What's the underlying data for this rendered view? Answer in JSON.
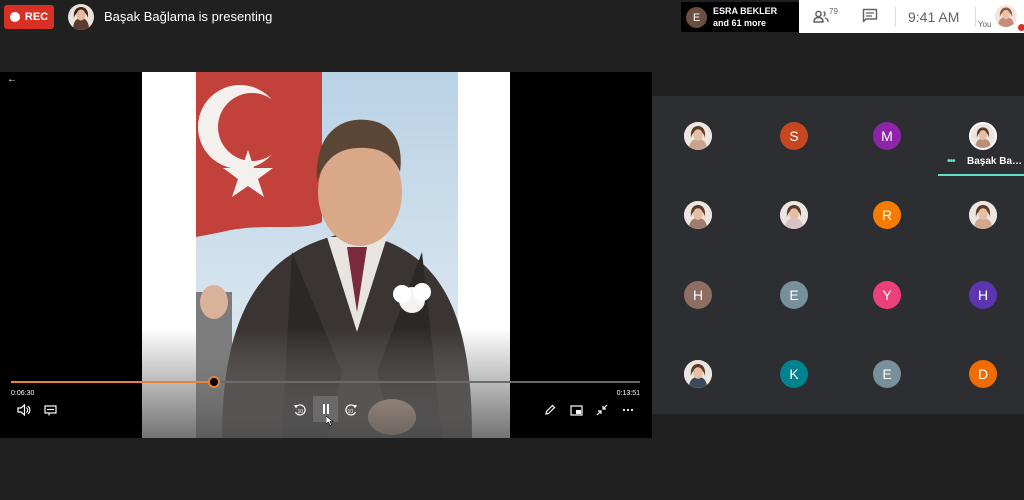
{
  "recording": {
    "label": "REC"
  },
  "presenter": {
    "text": "Başak Bağlama is presenting"
  },
  "participants_chip": {
    "initial": "E",
    "name": "ESRA BEKLER",
    "more": "and 61 more"
  },
  "toolbar": {
    "people_count": "79",
    "time": "9:41 AM",
    "you_label": "You"
  },
  "player": {
    "current_time": "0:06:30",
    "total_time": "0:13:51",
    "progress": 0.323
  },
  "grid": {
    "tiles": [
      {
        "type": "photo",
        "color": "#c9a38d"
      },
      {
        "type": "initial",
        "initial": "S",
        "color": "#c5461f"
      },
      {
        "type": "initial",
        "initial": "M",
        "color": "#8d24aa"
      },
      {
        "type": "photo",
        "color": "#b88f7a",
        "speaking": true,
        "name": "Başak Bağlama"
      },
      {
        "type": "photo",
        "color": "#a07a6a"
      },
      {
        "type": "photo",
        "color": "#d9c2c6"
      },
      {
        "type": "initial",
        "initial": "R",
        "color": "#f57c00"
      },
      {
        "type": "photo",
        "color": "#cfa890"
      },
      {
        "type": "initial",
        "initial": "H",
        "color": "#8d6e63"
      },
      {
        "type": "initial",
        "initial": "E",
        "color": "#78909c"
      },
      {
        "type": "initial",
        "initial": "Y",
        "color": "#ec407a"
      },
      {
        "type": "initial",
        "initial": "H",
        "color": "#5e35b1"
      },
      {
        "type": "photo",
        "color": "#3b4a5a"
      },
      {
        "type": "initial",
        "initial": "K",
        "color": "#00838f"
      },
      {
        "type": "initial",
        "initial": "E",
        "color": "#78909c"
      },
      {
        "type": "initial",
        "initial": "D",
        "color": "#ef6c00"
      }
    ]
  }
}
